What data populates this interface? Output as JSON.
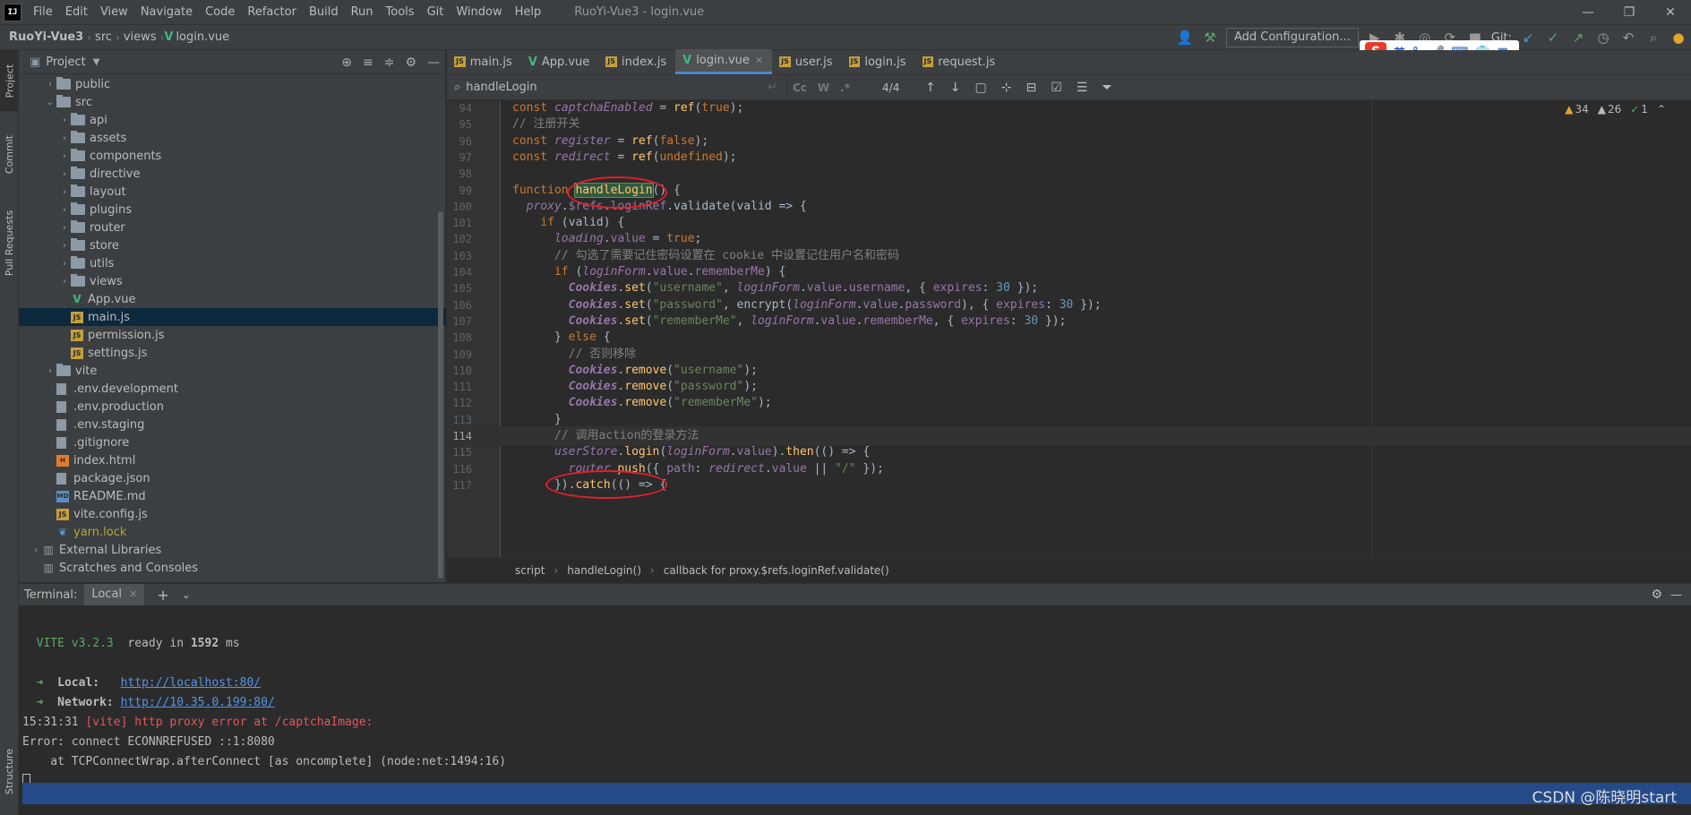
{
  "menubar": {
    "logo": "IJ",
    "items": [
      "File",
      "Edit",
      "View",
      "Navigate",
      "Code",
      "Refactor",
      "Build",
      "Run",
      "Tools",
      "Git",
      "Window",
      "Help"
    ],
    "title": "RuoYi-Vue3 - login.vue"
  },
  "navbar": {
    "crumbs": [
      "RuoYi-Vue3",
      "src",
      "views",
      "login.vue"
    ],
    "add_configuration": "Add Configuration...",
    "git_label": "Git:"
  },
  "left_strip": {
    "tabs": [
      "Project",
      "Commit",
      "Pull Requests",
      "Structure"
    ]
  },
  "project": {
    "title": "Project",
    "tree": [
      {
        "label": "public",
        "kind": "folder",
        "depth": 1,
        "arrow": "›"
      },
      {
        "label": "src",
        "kind": "folder",
        "depth": 1,
        "arrow": "⌄"
      },
      {
        "label": "api",
        "kind": "folder",
        "depth": 2,
        "arrow": "›"
      },
      {
        "label": "assets",
        "kind": "folder",
        "depth": 2,
        "arrow": "›"
      },
      {
        "label": "components",
        "kind": "folder",
        "depth": 2,
        "arrow": "›"
      },
      {
        "label": "directive",
        "kind": "folder",
        "depth": 2,
        "arrow": "›"
      },
      {
        "label": "layout",
        "kind": "folder",
        "depth": 2,
        "arrow": "›"
      },
      {
        "label": "plugins",
        "kind": "folder",
        "depth": 2,
        "arrow": "›"
      },
      {
        "label": "router",
        "kind": "folder",
        "depth": 2,
        "arrow": "›"
      },
      {
        "label": "store",
        "kind": "folder",
        "depth": 2,
        "arrow": "›"
      },
      {
        "label": "utils",
        "kind": "folder",
        "depth": 2,
        "arrow": "›"
      },
      {
        "label": "views",
        "kind": "folder",
        "depth": 2,
        "arrow": "›"
      },
      {
        "label": "App.vue",
        "kind": "vue",
        "depth": 2,
        "arrow": ""
      },
      {
        "label": "main.js",
        "kind": "js",
        "depth": 2,
        "arrow": "",
        "selected": true
      },
      {
        "label": "permission.js",
        "kind": "js",
        "depth": 2,
        "arrow": ""
      },
      {
        "label": "settings.js",
        "kind": "js",
        "depth": 2,
        "arrow": ""
      },
      {
        "label": "vite",
        "kind": "folder",
        "depth": 1,
        "arrow": "›"
      },
      {
        "label": ".env.development",
        "kind": "file",
        "depth": 1,
        "arrow": ""
      },
      {
        "label": ".env.production",
        "kind": "file",
        "depth": 1,
        "arrow": ""
      },
      {
        "label": ".env.staging",
        "kind": "file",
        "depth": 1,
        "arrow": ""
      },
      {
        "label": ".gitignore",
        "kind": "file",
        "depth": 1,
        "arrow": ""
      },
      {
        "label": "index.html",
        "kind": "html",
        "depth": 1,
        "arrow": ""
      },
      {
        "label": "package.json",
        "kind": "file",
        "depth": 1,
        "arrow": ""
      },
      {
        "label": "README.md",
        "kind": "md",
        "depth": 1,
        "arrow": ""
      },
      {
        "label": "vite.config.js",
        "kind": "js",
        "depth": 1,
        "arrow": ""
      },
      {
        "label": "yarn.lock",
        "kind": "yarn",
        "depth": 1,
        "arrow": ""
      },
      {
        "label": "External Libraries",
        "kind": "lib",
        "depth": 0,
        "arrow": "›"
      },
      {
        "label": "Scratches and Consoles",
        "kind": "lib",
        "depth": 0,
        "arrow": ""
      }
    ]
  },
  "tabs": [
    {
      "label": "main.js",
      "kind": "js"
    },
    {
      "label": "App.vue",
      "kind": "vue"
    },
    {
      "label": "index.js",
      "kind": "js"
    },
    {
      "label": "login.vue",
      "kind": "vue",
      "active": true
    },
    {
      "label": "user.js",
      "kind": "js"
    },
    {
      "label": "login.js",
      "kind": "js"
    },
    {
      "label": "request.js",
      "kind": "js"
    }
  ],
  "find": {
    "query": "handleLogin",
    "count": "4/4",
    "opt_cc": "Cc",
    "opt_w": "W",
    "opt_re": ".*"
  },
  "inspections": {
    "warnings": "34",
    "weak": "26",
    "ok": "1"
  },
  "code_lines": [
    {
      "n": "94",
      "html": "<span class='kw'>const </span><span class='vr'>captchaEnabled</span> = <span class='fn'>ref</span>(<span class='kw'>true</span>);"
    },
    {
      "n": "95",
      "html": "<span class='cm'>// 注册开关</span>"
    },
    {
      "n": "96",
      "html": "<span class='kw'>const </span><span class='vr'>register</span> = <span class='fn'>ref</span>(<span class='kw'>false</span>);"
    },
    {
      "n": "97",
      "html": "<span class='kw'>const </span><span class='vr'>redirect</span> = <span class='fn'>ref</span>(<span class='kw'>undefined</span>);"
    },
    {
      "n": "98",
      "html": ""
    },
    {
      "n": "99",
      "html": "<span class='kw'>function </span><span class='fn hl'>handleLogin</span>() {"
    },
    {
      "n": "100",
      "html": "  <span class='vr'>proxy</span>.<span class='prop'>$refs</span>.<span class='prop'>loginRef</span>.validate(valid => {"
    },
    {
      "n": "101",
      "html": "    <span class='kw'>if </span>(valid) {"
    },
    {
      "n": "102",
      "html": "      <span class='vr'>loading</span>.<span class='prop'>value</span> = <span class='kw'>true</span>;"
    },
    {
      "n": "103",
      "html": "      <span class='cm'>// 勾选了需要记住密码设置在 cookie 中设置记住用户名和密码</span>"
    },
    {
      "n": "104",
      "html": "      <span class='kw'>if </span>(<span class='vr'>loginForm</span>.<span class='prop'>value</span>.<span class='prop'>rememberMe</span>) {"
    },
    {
      "n": "105",
      "html": "        <span class='cls'>Cookies</span>.<span class='fn'>set</span>(<span class='str'>\"username\"</span>, <span class='vr'>loginForm</span>.<span class='prop'>value</span>.<span class='prop'>username</span>, { <span class='prop'>expires</span>: <span class='num'>30</span> });"
    },
    {
      "n": "106",
      "html": "        <span class='cls'>Cookies</span>.<span class='fn'>set</span>(<span class='str'>\"password\"</span>, encrypt(<span class='vr'>loginForm</span>.<span class='prop'>value</span>.<span class='prop'>password</span>), { <span class='prop'>expires</span>: <span class='num'>30</span> });"
    },
    {
      "n": "107",
      "html": "        <span class='cls'>Cookies</span>.<span class='fn'>set</span>(<span class='str'>\"rememberMe\"</span>, <span class='vr'>loginForm</span>.<span class='prop'>value</span>.<span class='prop'>rememberMe</span>, { <span class='prop'>expires</span>: <span class='num'>30</span> });"
    },
    {
      "n": "108",
      "html": "      } <span class='kw'>else </span>{"
    },
    {
      "n": "109",
      "html": "        <span class='cm'>// 否则移除</span>"
    },
    {
      "n": "110",
      "html": "        <span class='cls'>Cookies</span>.<span class='fn'>remove</span>(<span class='str'>\"username\"</span>);"
    },
    {
      "n": "111",
      "html": "        <span class='cls'>Cookies</span>.<span class='fn'>remove</span>(<span class='str'>\"password\"</span>);"
    },
    {
      "n": "112",
      "html": "        <span class='cls'>Cookies</span>.<span class='fn'>remove</span>(<span class='str'>\"rememberMe\"</span>);"
    },
    {
      "n": "113",
      "html": "      }"
    },
    {
      "n": "114",
      "html": "      <span class='cm'>// 调用action的登录方法</span>",
      "current": true
    },
    {
      "n": "115",
      "html": "      <span class='vr'>userStore</span>.<span class='fn'>login</span>(<span class='vr'>loginForm</span>.<span class='prop'>value</span>).<span class='fn'>then</span>(() => {"
    },
    {
      "n": "116",
      "html": "        <span class='vr'>router</span>.<span class='fn'>push</span>({ <span class='prop'>path</span>: <span class='vr'>redirect</span>.<span class='prop'>value</span> || <span class='str'>\"/\"</span> });"
    },
    {
      "n": "117",
      "html": "      }).<span class='fn'>catch</span>(() => {"
    }
  ],
  "breadcrumb": [
    "script",
    "handleLogin()",
    "callback for proxy.$refs.loginRef.validate()"
  ],
  "terminal": {
    "label": "Terminal:",
    "tab": "Local",
    "vite_name": "VITE v3.2.3",
    "vite_ready": "ready in",
    "vite_ms": "1592",
    "vite_unit": "ms",
    "local_label": "Local:",
    "local_url": "http://localhost:80/",
    "network_label": "Network:",
    "network_url": "http://10.35.0.199:80/",
    "err_time": "15:31:31",
    "err_msg": "[vite] http proxy error at /captchaImage:",
    "err_line1": "Error: connect ECONNREFUSED ::1:8080",
    "err_line2": "    at TCPConnectWrap.afterConnect [as oncomplete] (node:net:1494:16)"
  },
  "watermark": "CSDN @陈晓明start",
  "ime": {
    "lang": "英"
  }
}
